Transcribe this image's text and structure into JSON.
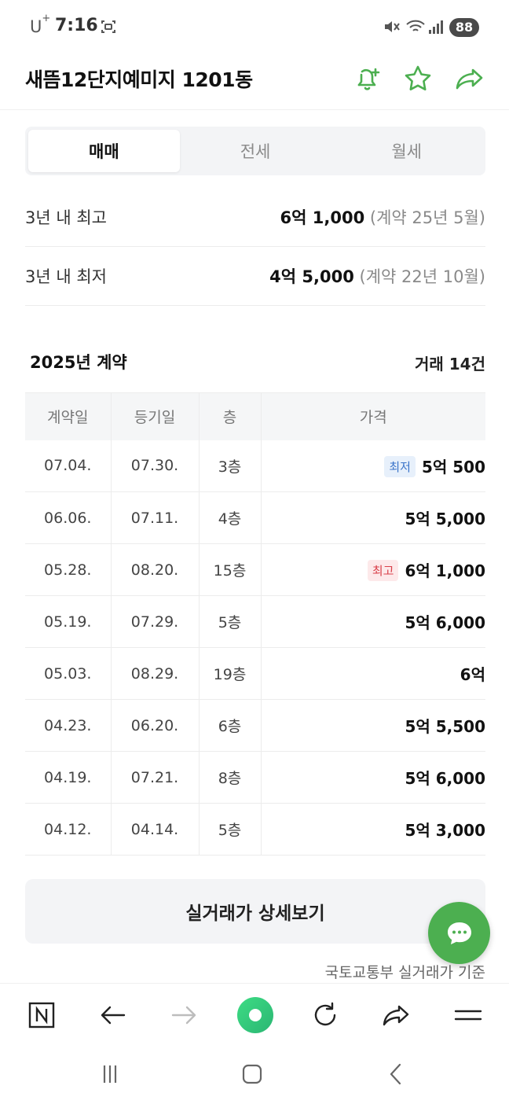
{
  "status": {
    "carrier": "U",
    "carrier_sup": "+",
    "time": "7:16",
    "battery": "88"
  },
  "header": {
    "title": "새뜸12단지예미지 1201동"
  },
  "tabs": [
    {
      "label": "매매",
      "active": true
    },
    {
      "label": "전세",
      "active": false
    },
    {
      "label": "월세",
      "active": false
    }
  ],
  "summary": {
    "high": {
      "label": "3년 내 최고",
      "price": "6억 1,000",
      "note": "(계약 25년 5월)"
    },
    "low": {
      "label": "3년 내 최저",
      "price": "4억 5,000",
      "note": "(계약 22년 10월)"
    }
  },
  "section": {
    "title": "2025년 계약",
    "count": "거래 14건"
  },
  "table": {
    "headers": [
      "계약일",
      "등기일",
      "층",
      "가격"
    ],
    "rows": [
      {
        "contract": "07.04.",
        "registered": "07.30.",
        "floor": "3층",
        "badge": "최저",
        "badge_type": "low",
        "price": "5억 500"
      },
      {
        "contract": "06.06.",
        "registered": "07.11.",
        "floor": "4층",
        "badge": "",
        "badge_type": "",
        "price": "5억 5,000"
      },
      {
        "contract": "05.28.",
        "registered": "08.20.",
        "floor": "15층",
        "badge": "최고",
        "badge_type": "high",
        "price": "6억 1,000"
      },
      {
        "contract": "05.19.",
        "registered": "07.29.",
        "floor": "5층",
        "badge": "",
        "badge_type": "",
        "price": "5억 6,000"
      },
      {
        "contract": "05.03.",
        "registered": "08.29.",
        "floor": "19층",
        "badge": "",
        "badge_type": "",
        "price": "6억"
      },
      {
        "contract": "04.23.",
        "registered": "06.20.",
        "floor": "6층",
        "badge": "",
        "badge_type": "",
        "price": "5억 5,500"
      },
      {
        "contract": "04.19.",
        "registered": "07.21.",
        "floor": "8층",
        "badge": "",
        "badge_type": "",
        "price": "5억 6,000"
      },
      {
        "contract": "04.12.",
        "registered": "04.14.",
        "floor": "5층",
        "badge": "",
        "badge_type": "",
        "price": "5억 3,000"
      }
    ]
  },
  "detail_button": {
    "label": "실거래가 상세보기"
  },
  "source": {
    "text": "국토교통부 실거래가 기준"
  },
  "colors": {
    "accent": "#4caf50",
    "low_badge": "#3b74c9",
    "high_badge": "#d9404a"
  },
  "icons": {
    "header": [
      "bell-plus-icon",
      "star-icon",
      "share-icon"
    ],
    "toolbar": [
      "naver-home-icon",
      "back-arrow-icon",
      "forward-arrow-icon",
      "green-dot-icon",
      "refresh-icon",
      "share-icon",
      "menu-icon"
    ],
    "nav": [
      "recent-apps-icon",
      "home-icon",
      "back-icon"
    ]
  }
}
